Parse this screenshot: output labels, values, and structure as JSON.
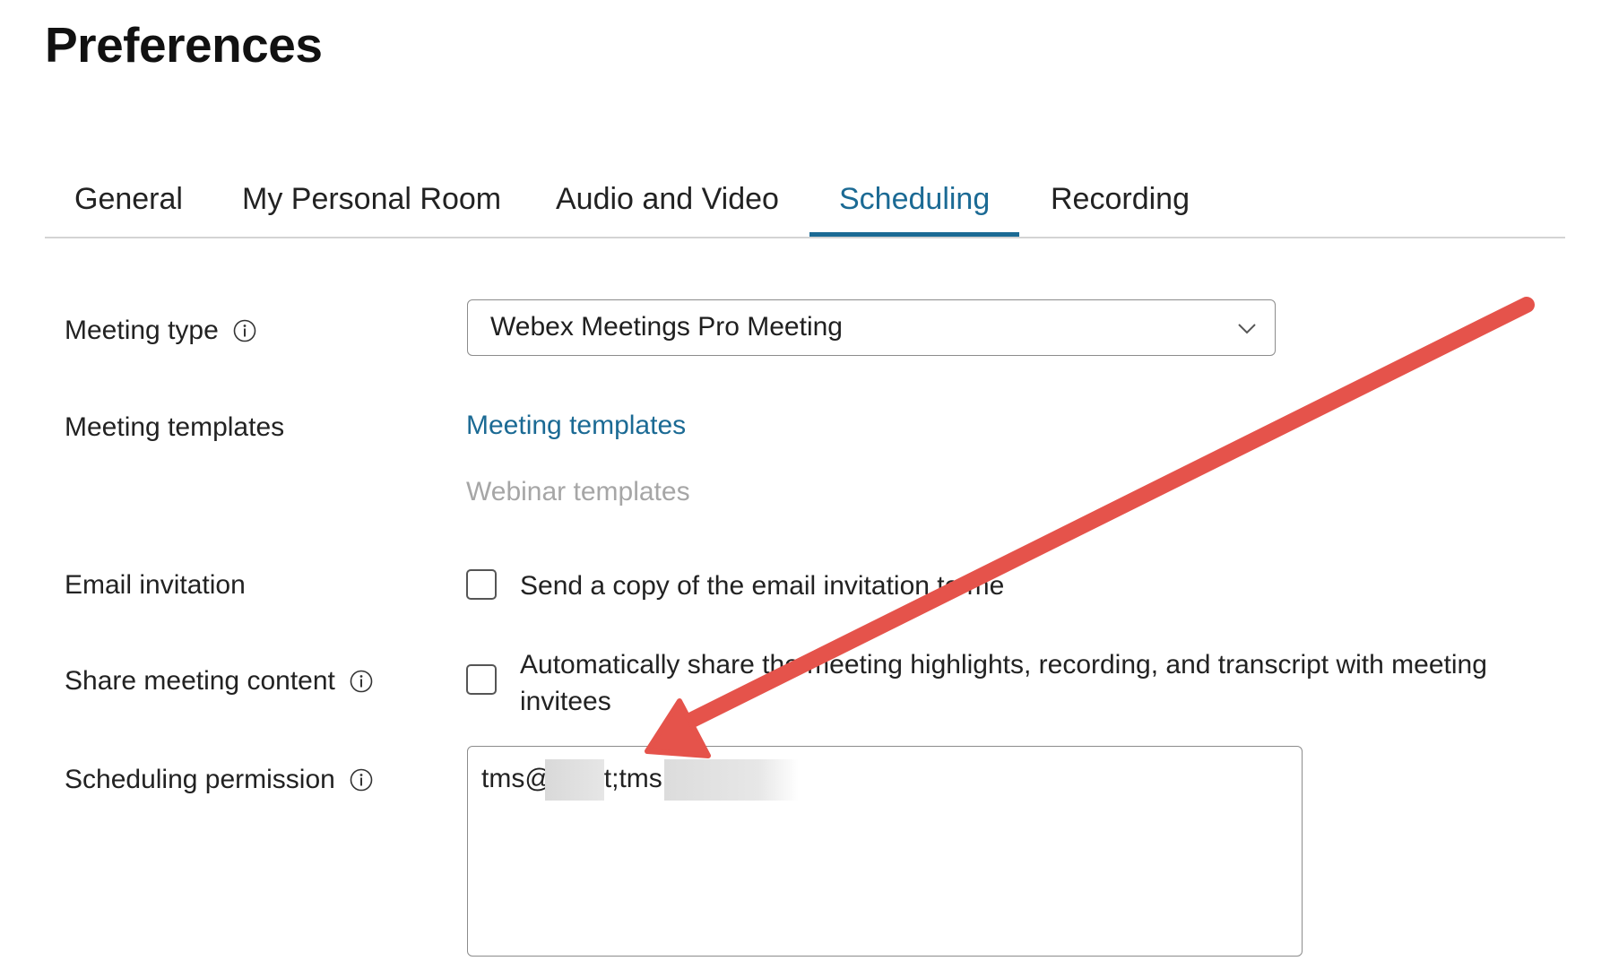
{
  "page": {
    "title": "Preferences"
  },
  "tabs": [
    {
      "label": "General"
    },
    {
      "label": "My Personal Room"
    },
    {
      "label": "Audio and Video"
    },
    {
      "label": "Scheduling",
      "active": true
    },
    {
      "label": "Recording"
    }
  ],
  "form": {
    "meeting_type": {
      "label": "Meeting type",
      "value": "Webex Meetings Pro Meeting"
    },
    "meeting_templates": {
      "label": "Meeting templates",
      "link_meeting": "Meeting templates",
      "link_webinar": "Webinar templates"
    },
    "email_invitation": {
      "label": "Email invitation",
      "checkbox_text": "Send a copy of the email invitation to me",
      "checked": false
    },
    "share_meeting_content": {
      "label": "Share meeting content",
      "checkbox_line1": "Automatically share the meeting highlights, recording, and transcript with meeting",
      "checkbox_line2": "invitees",
      "checked": false
    },
    "scheduling_permission": {
      "label": "Scheduling permission",
      "value_start": "tms@",
      "value_mid": "t;tms"
    }
  },
  "colors": {
    "accent": "#1b6a94",
    "annotation_arrow": "#e5534b",
    "disabled_link": "#a6a6a6"
  },
  "icons": {
    "info": "info-circle-icon",
    "dropdown": "chevron-down-icon",
    "annotation": "red-arrow-annotation"
  }
}
